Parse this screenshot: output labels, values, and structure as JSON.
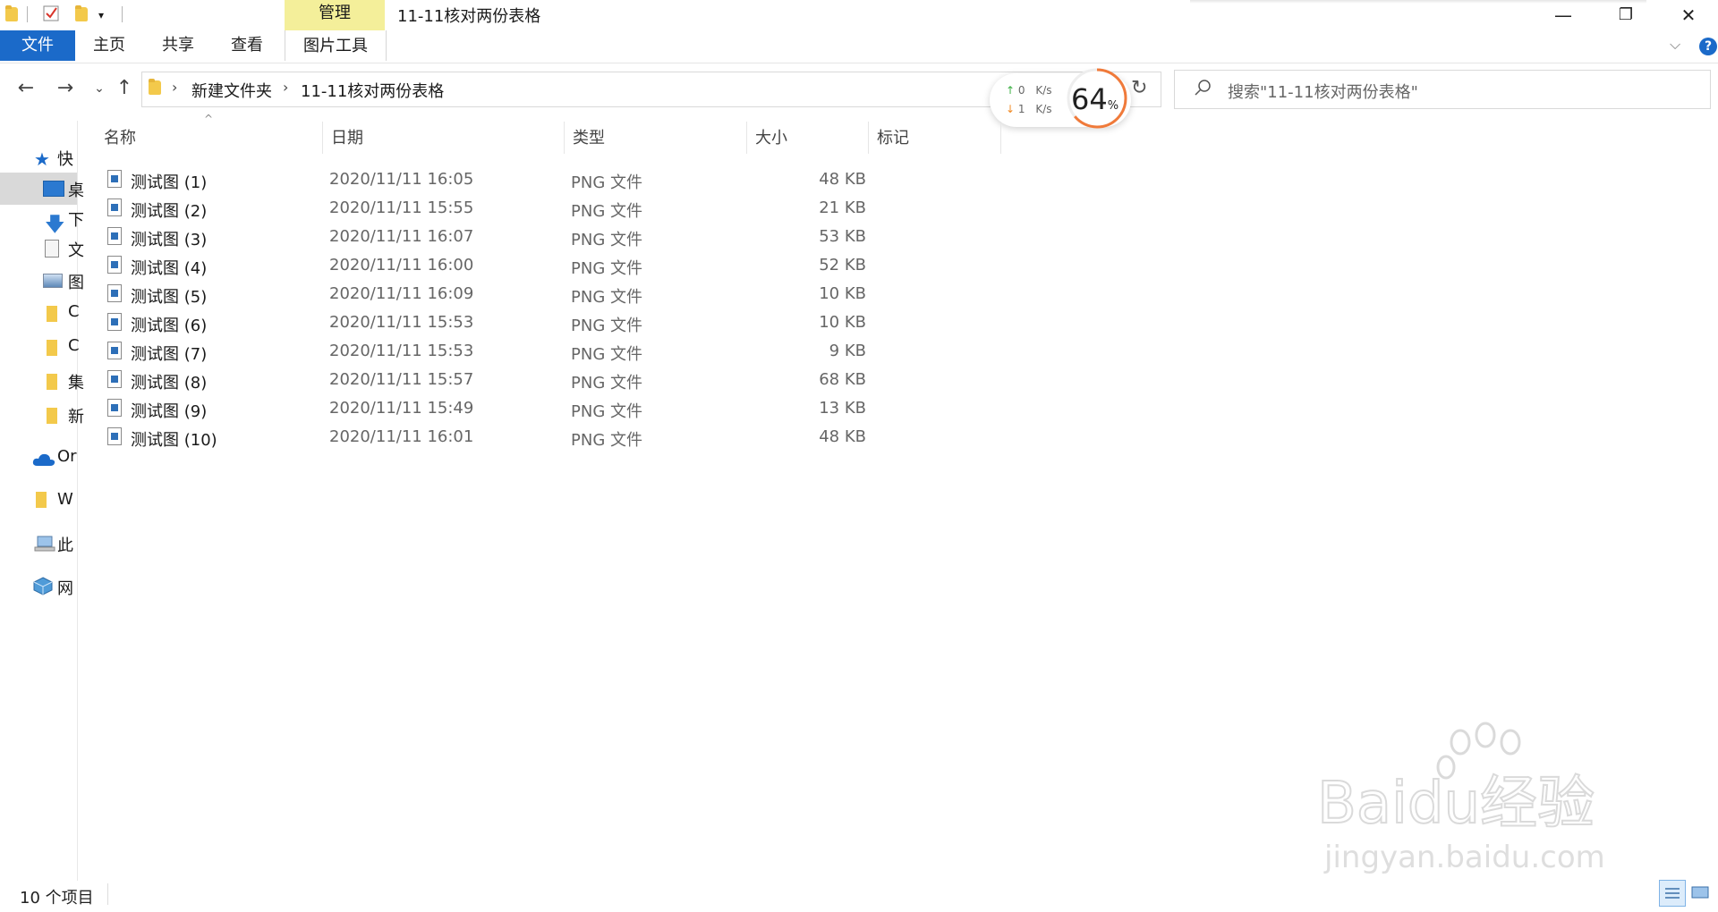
{
  "window": {
    "title": "11-11核对两份表格",
    "manage_tab": "管理",
    "minimize": "—",
    "restore": "❐",
    "close": "✕"
  },
  "ribbon": {
    "file": "文件",
    "tabs": [
      "主页",
      "共享",
      "查看"
    ],
    "picture_tools": "图片工具",
    "help": "?"
  },
  "address": {
    "breadcrumb": [
      "新建文件夹",
      "11-11核对两份表格"
    ],
    "search_placeholder": "搜索\"11-11核对两份表格\""
  },
  "speed_widget": {
    "upload": "0",
    "download": "1",
    "unit": "K/s",
    "percent": "64",
    "percent_sign": "%"
  },
  "nav_pane": {
    "items": [
      "快",
      "桌",
      "下",
      "文",
      "图",
      "C",
      "C",
      "集",
      "新"
    ],
    "onedrive": "Or",
    "w_folder": "W",
    "this_pc": "此",
    "network": "网"
  },
  "columns": {
    "name": "名称",
    "date": "日期",
    "type": "类型",
    "size": "大小",
    "tags": "标记"
  },
  "files": [
    {
      "name": "测试图 (1)",
      "date": "2020/11/11 16:05",
      "type": "PNG 文件",
      "size": "48 KB"
    },
    {
      "name": "测试图 (2)",
      "date": "2020/11/11 15:55",
      "type": "PNG 文件",
      "size": "21 KB"
    },
    {
      "name": "测试图 (3)",
      "date": "2020/11/11 16:07",
      "type": "PNG 文件",
      "size": "53 KB"
    },
    {
      "name": "测试图 (4)",
      "date": "2020/11/11 16:00",
      "type": "PNG 文件",
      "size": "52 KB"
    },
    {
      "name": "测试图 (5)",
      "date": "2020/11/11 16:09",
      "type": "PNG 文件",
      "size": "10 KB"
    },
    {
      "name": "测试图 (6)",
      "date": "2020/11/11 15:53",
      "type": "PNG 文件",
      "size": "10 KB"
    },
    {
      "name": "测试图 (7)",
      "date": "2020/11/11 15:53",
      "type": "PNG 文件",
      "size": "9 KB"
    },
    {
      "name": "测试图 (8)",
      "date": "2020/11/11 15:57",
      "type": "PNG 文件",
      "size": "68 KB"
    },
    {
      "name": "测试图 (9)",
      "date": "2020/11/11 15:49",
      "type": "PNG 文件",
      "size": "13 KB"
    },
    {
      "name": "测试图 (10)",
      "date": "2020/11/11 16:01",
      "type": "PNG 文件",
      "size": "48 KB"
    }
  ],
  "status": {
    "item_count": "10 个项目"
  },
  "watermark": {
    "brand": "Baidu经验",
    "url": "jingyan.baidu.com"
  }
}
